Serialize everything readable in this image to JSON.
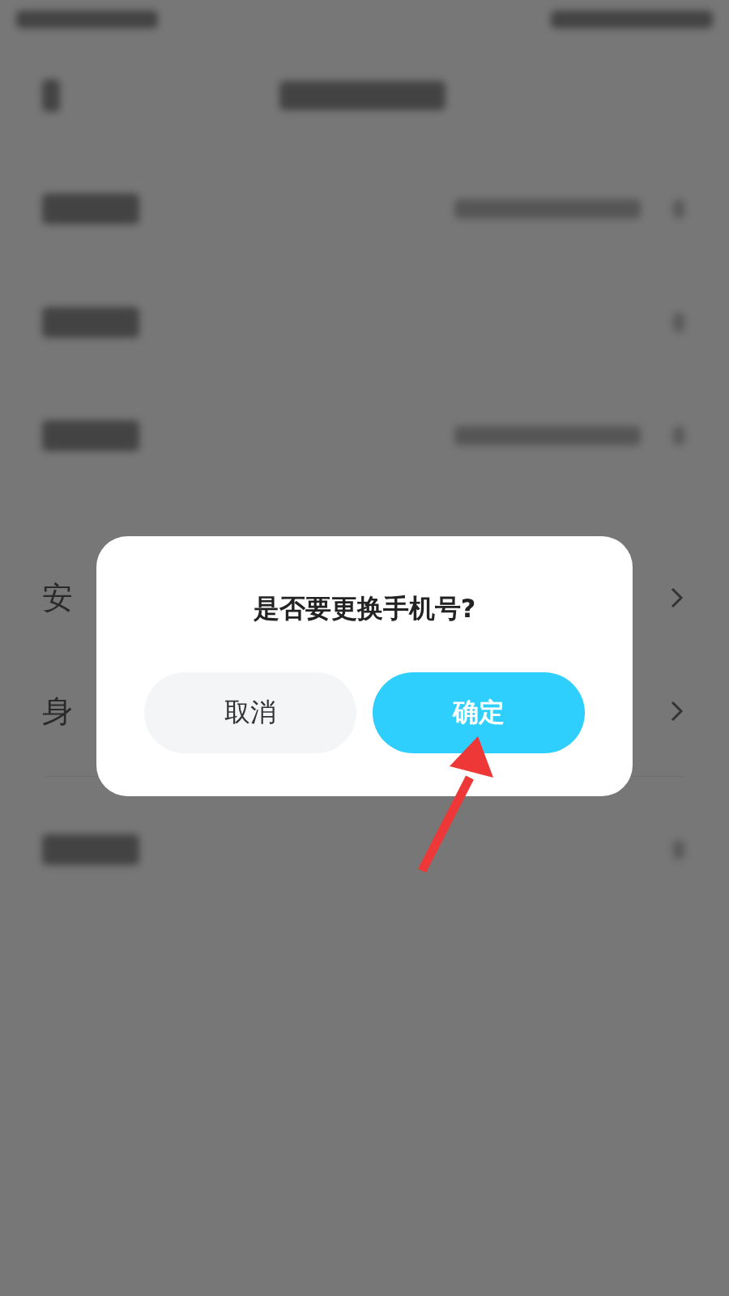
{
  "background_rows": [
    {
      "kind": "blurred",
      "has_value": true
    },
    {
      "kind": "blurred",
      "has_value": false
    },
    {
      "kind": "blurred",
      "has_value": true
    },
    {
      "kind": "partial",
      "label": "安"
    },
    {
      "kind": "partial",
      "label": "身"
    },
    {
      "kind": "blurred",
      "has_value": false
    }
  ],
  "dialog": {
    "title": "是否要更换手机号?",
    "buttons": [
      {
        "label": "取消",
        "kind": "secondary"
      },
      {
        "label": "确定",
        "kind": "primary"
      }
    ]
  },
  "annotation": {
    "kind": "arrow"
  }
}
